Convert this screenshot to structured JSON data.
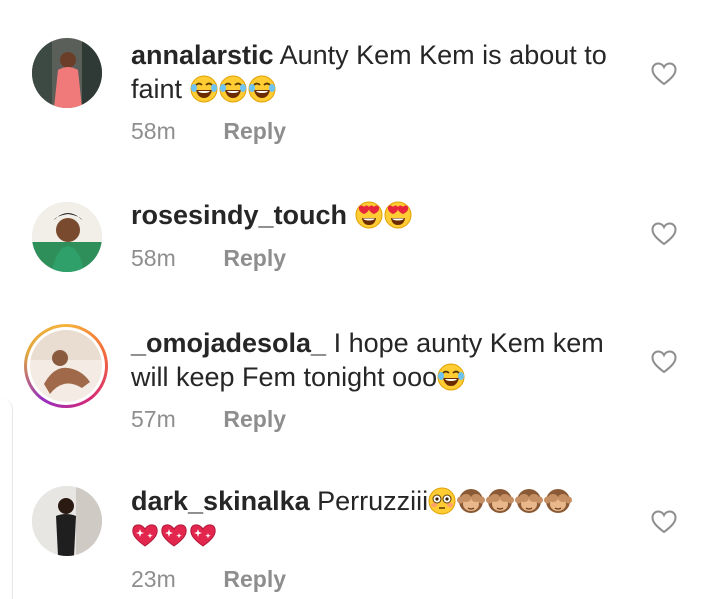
{
  "comments": [
    {
      "username": "annalarstic",
      "text": "Aunty Kem Kem is about to",
      "text2": "faint",
      "time": "58m",
      "reply": "Reply"
    },
    {
      "username": "rosesindy_touch",
      "text": "",
      "time": "58m",
      "reply": "Reply"
    },
    {
      "username": "_omojadesola_",
      "text": "I hope aunty Kem kem",
      "text2": "will keep Fem tonight ooo",
      "time": "57m",
      "reply": "Reply"
    },
    {
      "username": "dark_skinalka",
      "text": "Perruzziii",
      "time": "23m",
      "reply": "Reply"
    }
  ],
  "icons": {
    "like": "heart-outline-icon",
    "laugh": "face-with-tears-of-joy",
    "heart_eyes": "smiling-face-with-heart-eyes",
    "flushed": "flushed-face",
    "monkey": "see-no-evil-monkey",
    "sparkle_heart": "sparkling-heart"
  },
  "colors": {
    "text": "#262626",
    "meta": "#8e8e8e",
    "background": "#ffffff"
  }
}
